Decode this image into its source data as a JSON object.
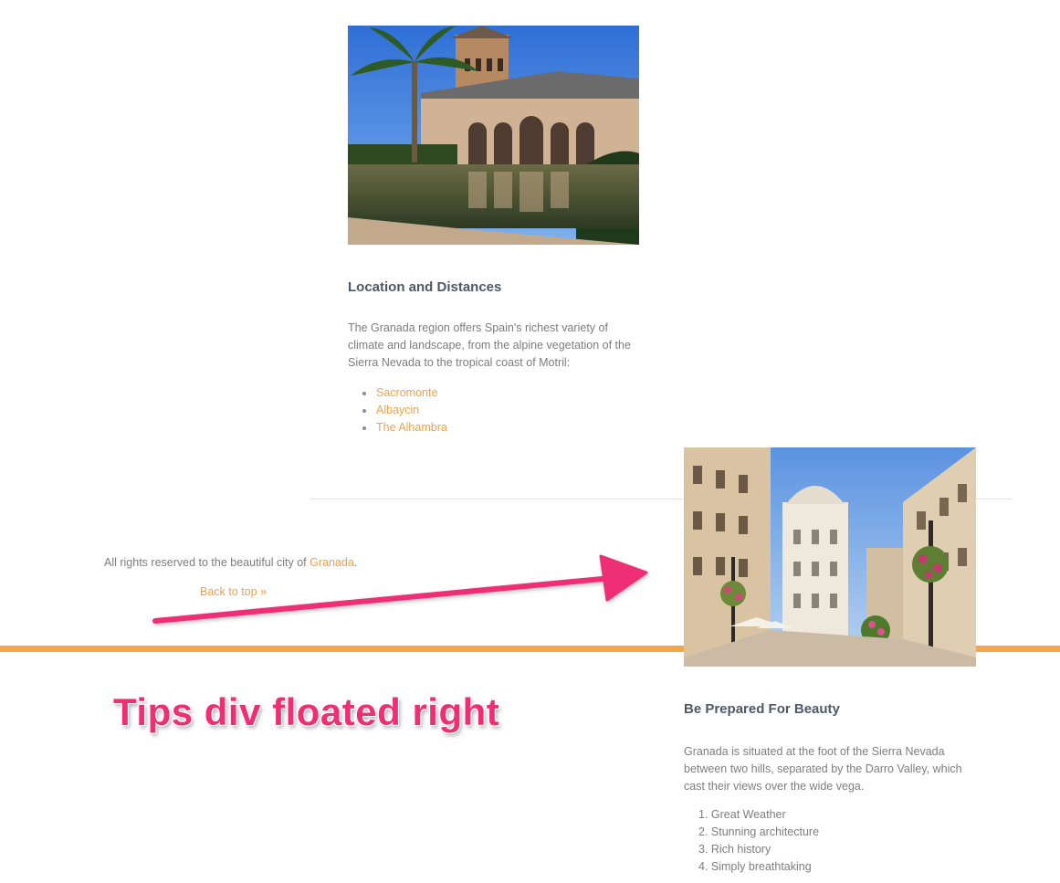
{
  "images": {
    "alhambra_photo": "Alhambra palace photo",
    "street_photo": "Granada street photo"
  },
  "location": {
    "heading": "Location and Distances",
    "text": "The Granada region offers Spain's richest variety of climate and landscape, from the alpine vegetation of the Sierra Nevada to the tropical coast of Motril:",
    "links": [
      {
        "label": "Sacromonte"
      },
      {
        "label": "Albaycin"
      },
      {
        "label": "The Alhambra"
      }
    ]
  },
  "footer": {
    "copyright_prefix": "All rights reserved to the beautiful city of ",
    "copyright_link": "Granada",
    "copyright_suffix": ".",
    "back_to_top": "Back to top »",
    "bar_color": "#f3a74d"
  },
  "tips": {
    "heading": "Be Prepared For Beauty",
    "text": "Granada is situated at the foot of the Sierra Nevada between two hills, separated by the Darro Valley, which cast their views over the wide vega.",
    "items": [
      {
        "label": "Great Weather"
      },
      {
        "label": "Stunning architecture"
      },
      {
        "label": "Rich history"
      },
      {
        "label": "Simply breathtaking"
      }
    ]
  },
  "annotation": {
    "label": "Tips div floated right",
    "color": "#ee2f74"
  },
  "colors": {
    "link": "#f0a04b",
    "heading": "#4f5966",
    "body_text": "#7d7d7d",
    "divider": "#e3e3e3"
  }
}
